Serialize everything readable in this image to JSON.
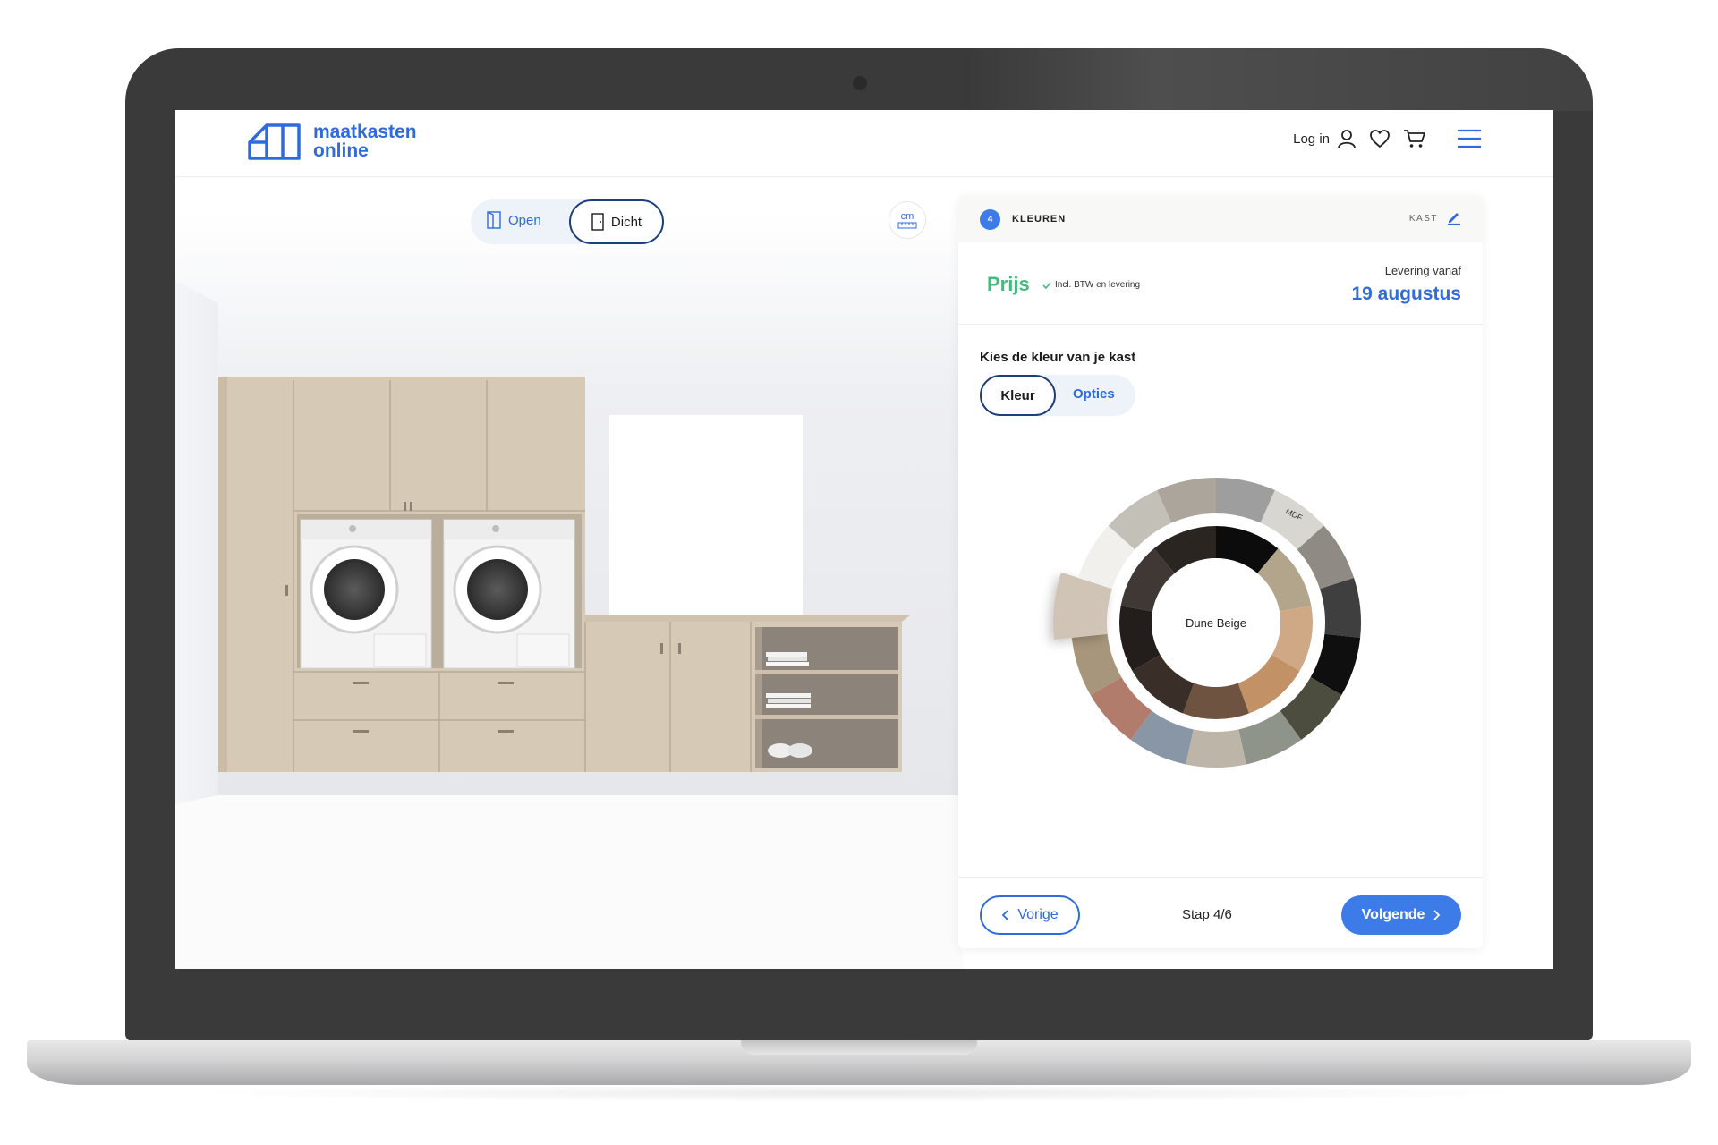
{
  "header": {
    "logo_line1": "maatkasten",
    "logo_line2": "online",
    "login_label": "Log in",
    "icons": [
      "logo-icon",
      "user-icon",
      "heart-icon",
      "cart-icon",
      "menu-icon"
    ]
  },
  "viewer": {
    "toggle_open": "Open",
    "toggle_closed": "Dicht",
    "unit_label": "cm",
    "icons": [
      "door-open-icon",
      "door-closed-icon",
      "ruler-icon"
    ]
  },
  "panel": {
    "step_number": "4",
    "step_title": "KLEUREN",
    "section_label": "KAST",
    "price_label": "Prijs",
    "price_note": "Incl. BTW en levering",
    "delivery_label": "Levering vanaf",
    "delivery_date": "19 augustus",
    "choose_title": "Kies de kleur van je kast",
    "tabs": [
      "Kleur",
      "Opties"
    ],
    "selected_color": "Dune Beige",
    "material_label": "MDF",
    "prev_label": "Vorige",
    "step_indicator": "Stap 4/6",
    "next_label": "Volgende"
  },
  "colors": {
    "brand": "#2f6bdc",
    "accent_button": "#3d7be8",
    "price_green": "#44bb7c",
    "cabinet": "#d6c9b6",
    "dark_outline": "#1d3f79"
  },
  "swatches": {
    "outer": [
      "#9e9e9e",
      "#d8d6d1",
      "#8f8a84",
      "#3f3f40",
      "#0f0f10",
      "#4c4d3f",
      "#8e9489",
      "#bcb5a8",
      "#8896a6",
      "#b27c6c",
      "#a7967c",
      "#cfc4b5",
      "#f1f0ed",
      "#c3c0b8",
      "#aba59c"
    ],
    "inner": [
      "#0c0c0c",
      "#b3a58b",
      "#cfa985",
      "#c29266",
      "#6e5440",
      "#3a2f28",
      "#231e1b",
      "#3f3834",
      "#2b2521"
    ]
  }
}
